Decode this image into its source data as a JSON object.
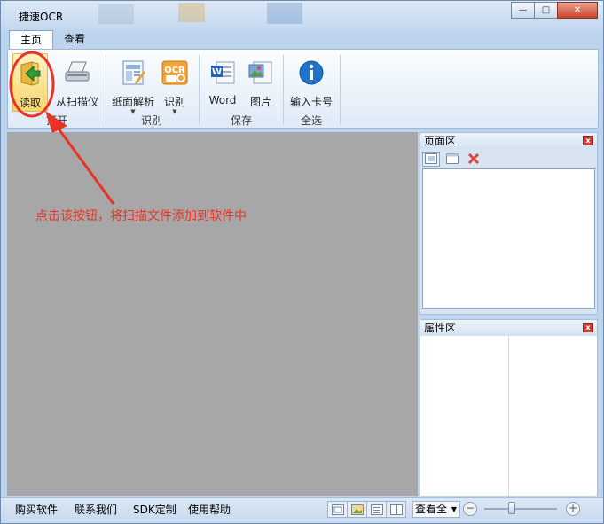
{
  "window": {
    "title": "捷速OCR",
    "minimize_glyph": "—",
    "maximize_glyph": "□",
    "close_glyph": "✕"
  },
  "tabs": [
    {
      "label": "主页",
      "active": true
    },
    {
      "label": "查看",
      "active": false
    }
  ],
  "ribbon": {
    "buttons": {
      "read": "读取",
      "scanner": "从扫描仪",
      "paper_analysis": "纸面解析",
      "recognize": "识别",
      "word": "Word",
      "image": "图片",
      "serial": "输入卡号"
    },
    "groups": {
      "open": "打开",
      "recognize": "识别",
      "save": "保存",
      "select_all": "全选"
    },
    "dropdown_glyph": "▼",
    "ocr_icon_text": "OCR"
  },
  "panels": {
    "page_area": {
      "title": "页面区",
      "close_glyph": "x"
    },
    "properties": {
      "title": "属性区",
      "close_glyph": "x"
    }
  },
  "annotation": {
    "text": "点击该按钮，将扫描文件添加到软件中",
    "color": "#e83325"
  },
  "statusbar": {
    "links": [
      "购买软件",
      "联系我们",
      "SDK定制",
      "使用帮助"
    ],
    "view_select": "查看全",
    "zoom_minus": "−",
    "zoom_plus": "+"
  },
  "colors": {
    "accent": "#e83325",
    "canvas": "#a7a7a7",
    "chrome": "#bcd4ee"
  }
}
